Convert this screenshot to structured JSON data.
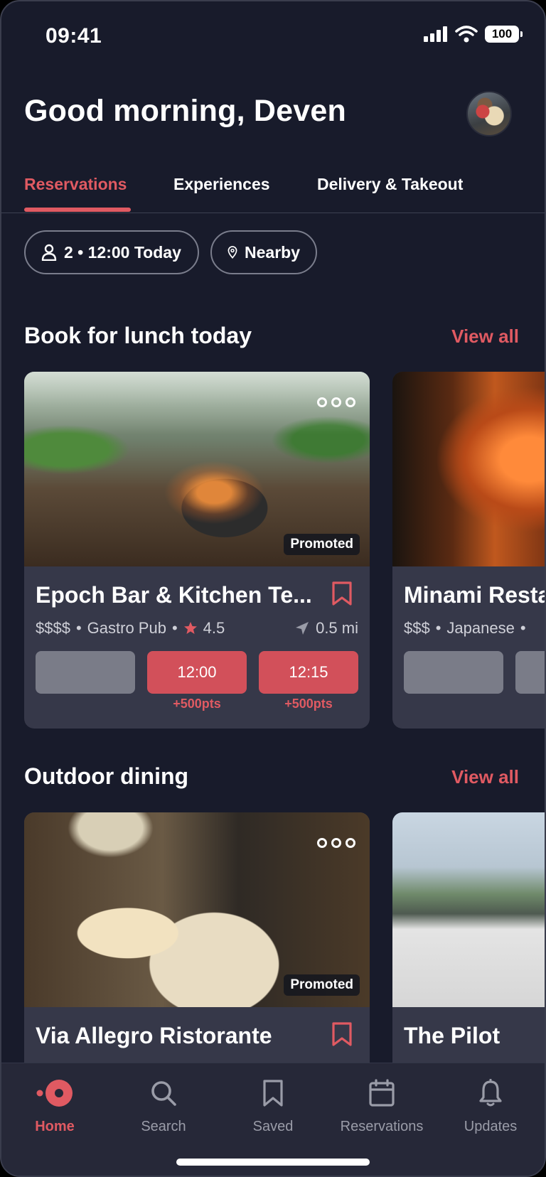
{
  "status": {
    "time": "09:41",
    "battery": "100"
  },
  "header": {
    "greeting": "Good morning, Deven"
  },
  "tabs": [
    {
      "label": "Reservations",
      "active": true
    },
    {
      "label": "Experiences",
      "active": false
    },
    {
      "label": "Delivery & Takeout",
      "active": false
    }
  ],
  "filters": {
    "party": "2 • 12:00 Today",
    "location": "Nearby"
  },
  "sections": {
    "lunch": {
      "title": "Book for lunch today",
      "view_all": "View all"
    },
    "outdoor": {
      "title": "Outdoor dining",
      "view_all": "View all"
    }
  },
  "lunch_cards": [
    {
      "name": "Epoch Bar & Kitchen Te...",
      "price": "$$$$",
      "cuisine": "Gastro Pub",
      "rating": "4.5",
      "distance": "0.5 mi",
      "promoted": "Promoted",
      "slots": [
        {
          "time": "",
          "points": ""
        },
        {
          "time": "12:00",
          "points": "+500pts"
        },
        {
          "time": "12:15",
          "points": "+500pts"
        }
      ]
    },
    {
      "name": "Minami Resta",
      "price": "$$$",
      "cuisine": "Japanese"
    }
  ],
  "outdoor_cards": [
    {
      "name": "Via Allegro Ristorante",
      "promoted": "Promoted"
    },
    {
      "name": "The Pilot"
    }
  ],
  "bottom_nav": [
    {
      "label": "Home",
      "icon": "home-icon",
      "active": true
    },
    {
      "label": "Search",
      "icon": "search-icon",
      "active": false
    },
    {
      "label": "Saved",
      "icon": "bookmark-icon",
      "active": false
    },
    {
      "label": "Reservations",
      "icon": "calendar-icon",
      "active": false
    },
    {
      "label": "Updates",
      "icon": "bell-icon",
      "active": false
    }
  ],
  "colors": {
    "accent": "#e05a62",
    "background": "#181b2b",
    "card": "#363849",
    "nav": "#262838"
  }
}
